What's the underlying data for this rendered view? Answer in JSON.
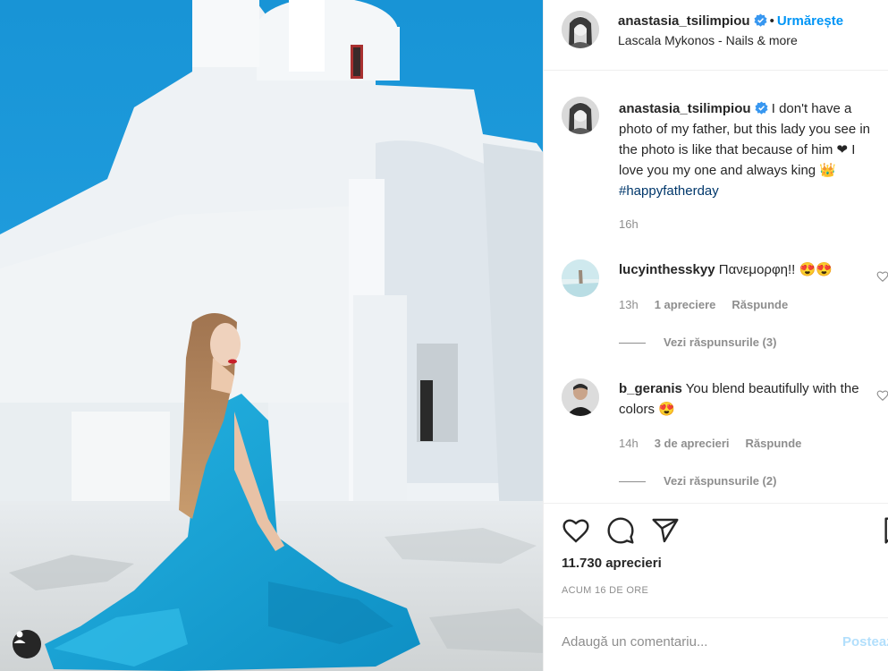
{
  "post": {
    "username": "anastasia_tsilimpiou",
    "follow_label": "Urmărește",
    "location": "Lascala Mykonos - Nails & more"
  },
  "caption": {
    "username": "anastasia_tsilimpiou",
    "text": "I don't have a photo of my father, but this lady you see in the photo is like that because of him ❤ I love you my one and always king 👑",
    "hashtag": "#happyfatherday",
    "time": "16h"
  },
  "comments": [
    {
      "username": "lucyinthesskyy",
      "text": "Πανεμορφη!! 😍😍",
      "time": "13h",
      "likes": "1 apreciere",
      "reply": "Răspunde",
      "view_replies": "Vezi răspunsurile (3)"
    },
    {
      "username": "b_geranis",
      "text": "You blend beautifully with the colors 😍",
      "time": "14h",
      "likes": "3 de aprecieri",
      "reply": "Răspunde",
      "view_replies": "Vezi răspunsurile (2)"
    }
  ],
  "actions": {
    "likes_count": "11.730 aprecieri",
    "posted_ago": "ACUM 16 DE ORE"
  },
  "add_comment": {
    "placeholder": "Adaugă un comentariu...",
    "post_label": "Postează"
  },
  "icons": {
    "like": "heart-icon",
    "comment": "comment-icon",
    "share": "share-icon",
    "save": "bookmark-icon",
    "tags": "user-tag-icon",
    "verified": "verified-badge-icon"
  },
  "colors": {
    "accent": "#0095f6",
    "verified": "#3897f0",
    "hashtag": "#00376b",
    "muted": "#8e8e8e",
    "sky": "#1f9ddb",
    "dress": "#1aa7d8"
  }
}
